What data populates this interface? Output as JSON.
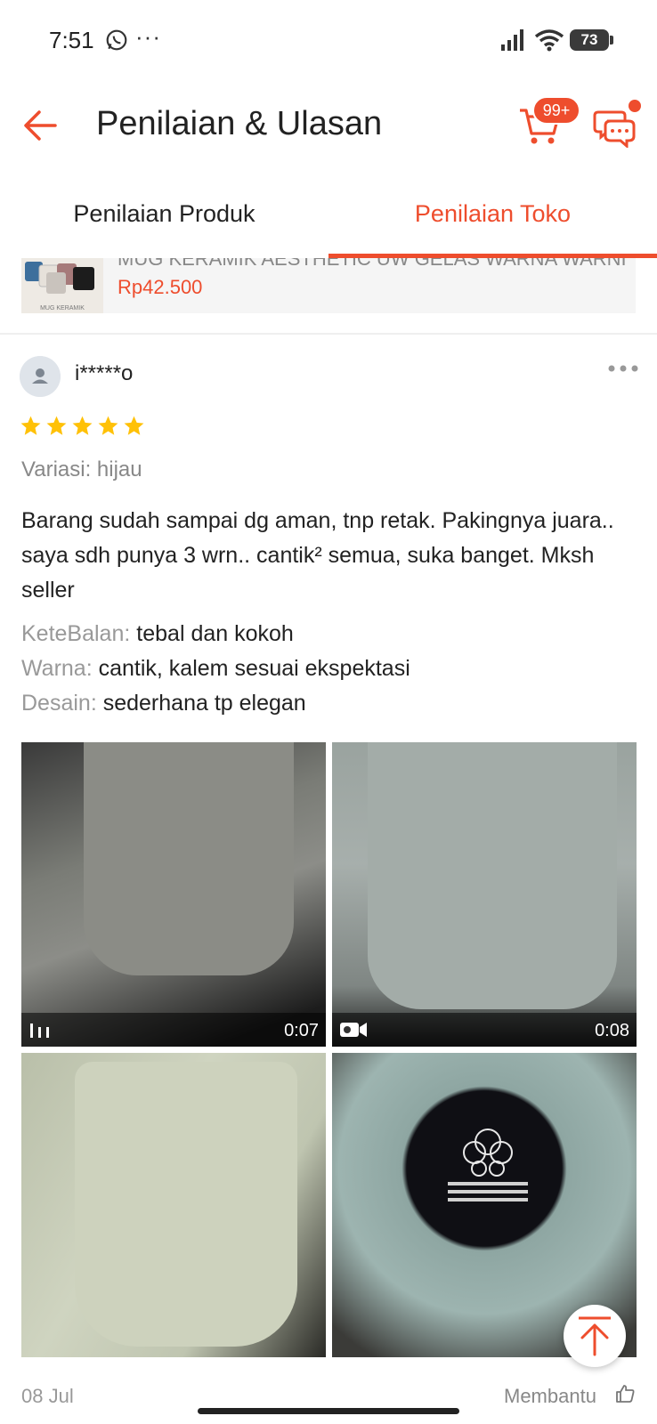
{
  "status_bar": {
    "time": "7:51",
    "battery": "73",
    "more": "···"
  },
  "header": {
    "title": "Penilaian & Ulasan",
    "cart_badge": "99+",
    "accent_color": "#ee4d2d"
  },
  "tabs": [
    {
      "label": "Penilaian Produk",
      "active": false
    },
    {
      "label": "Penilaian Toko",
      "active": true
    }
  ],
  "product": {
    "name": "MUG KERAMIK AESTHETIC UW GELAS WARNA WARNI...",
    "price": "Rp42.500",
    "thumb_caption": "MUG KERAMIK"
  },
  "review": {
    "username": "i*****o",
    "rating": 5,
    "variation": "Variasi: hijau",
    "text": "Barang sudah sampai dg aman, tnp retak. Pakingnya juara.. saya sdh punya 3 wrn.. cantik² semua, suka banget. Mksh seller",
    "attributes": [
      {
        "key": "KeteBalan:",
        "value": "tebal dan kokoh"
      },
      {
        "key": "Warna:",
        "value": "cantik, kalem sesuai ekspektasi"
      },
      {
        "key": "Desain:",
        "value": "sederhana tp elegan"
      }
    ],
    "media": [
      {
        "type": "video",
        "duration": "0:07"
      },
      {
        "type": "video",
        "duration": "0:08"
      },
      {
        "type": "image"
      },
      {
        "type": "image"
      }
    ],
    "date": "08 Jul",
    "helpful_label": "Membantu"
  }
}
